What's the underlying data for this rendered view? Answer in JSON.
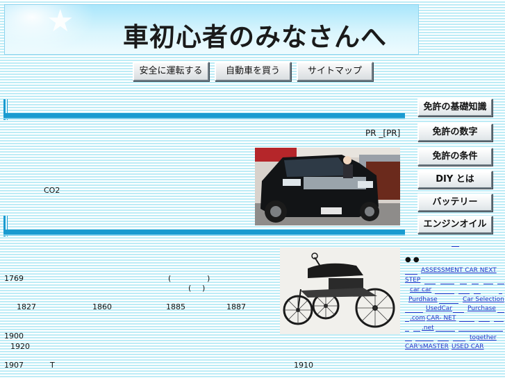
{
  "banner": {
    "title": "車初心者のみなさんへ"
  },
  "top_nav": [
    {
      "label": "安全に運転する"
    },
    {
      "label": "自動車を買う"
    },
    {
      "label": "サイトマップ"
    }
  ],
  "side_nav": [
    {
      "label": "免許の基礎知識"
    },
    {
      "label": "免許の数字"
    },
    {
      "label": "免許の条件"
    },
    {
      "label": "DIY とは"
    },
    {
      "label": "バッテリー"
    },
    {
      "label": "エンジンオイル"
    }
  ],
  "section1": {
    "pr_text": "PR _[PR]",
    "co2_text": "CO2"
  },
  "section2": {
    "row1": {
      "year": "1769",
      "paren_open": "(",
      "paren_close": ")"
    },
    "row2": {
      "paren_open": "(",
      "paren_close": ")"
    },
    "row3": [
      "1827",
      "1860",
      "1885",
      "1887"
    ],
    "row4": "1900",
    "row5": "1920",
    "row6": {
      "year": "1907",
      "letter": "T",
      "year2": "1910"
    }
  },
  "links": {
    "bullets": "●  ●",
    "items": [
      "ASSESSMENT CAR NEXT",
      "STEP",
      "car car",
      "Purdhase",
      "Car Selection",
      "UsedCar",
      "Purchase",
      ".com",
      "CAR- NET",
      ".net",
      "together",
      "CAR'sMASTER",
      "USED CAR"
    ]
  }
}
